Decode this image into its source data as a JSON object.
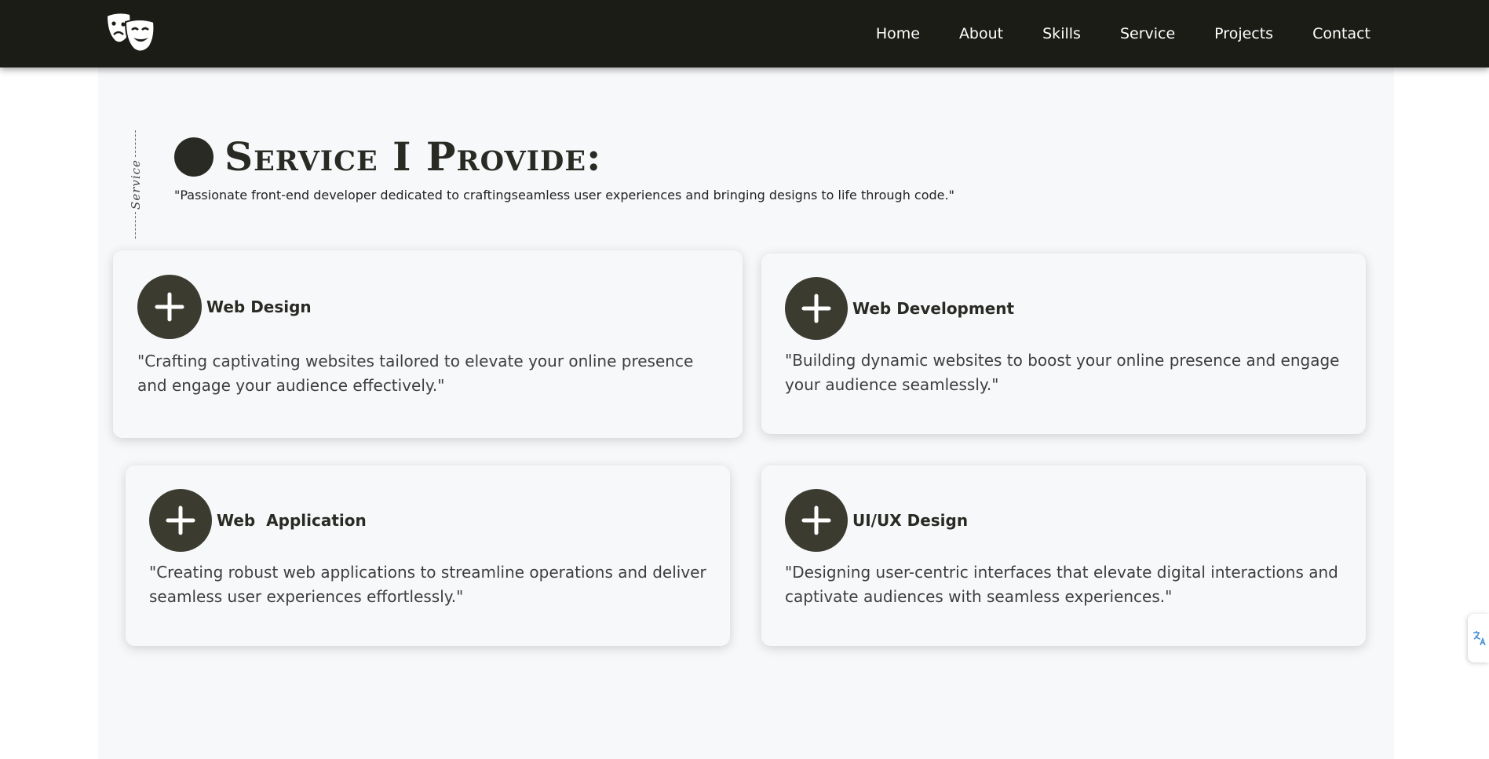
{
  "nav": {
    "logo_icon": "theater-masks-icon",
    "links": [
      "Home",
      "About",
      "Skills",
      "Service",
      "Projects",
      "Contact"
    ]
  },
  "section": {
    "side_label": "Service",
    "heading": "Service I Provide:",
    "subtitle": "\"Passionate front-end developer dedicated to craftingseamless user experiences and bringing designs to life through code.\""
  },
  "cards": [
    {
      "title": "Web Design",
      "description": "\"Crafting captivating websites tailored to elevate your online presence and engage your audience effectively.\"",
      "icon": "plus-icon"
    },
    {
      "title": "Web Development",
      "description": "\"Building dynamic websites to boost your online presence and engage your audience seamlessly.\"",
      "icon": "plus-icon"
    },
    {
      "title": "Web  Application",
      "description": "\"Creating robust web applications to streamline operations and deliver seamless user experiences effortlessly.\"",
      "icon": "plus-icon"
    },
    {
      "title": "UI/UX Design",
      "description": "\"Designing user-centric interfaces that elevate digital interactions and captivate audiences with seamless experiences.\"",
      "icon": "plus-icon"
    }
  ],
  "colors": {
    "navbar": "#1c1c17",
    "icon_circle": "#3b3b30",
    "page_bg": "#f7f8fa",
    "heading": "#2a2a24"
  }
}
